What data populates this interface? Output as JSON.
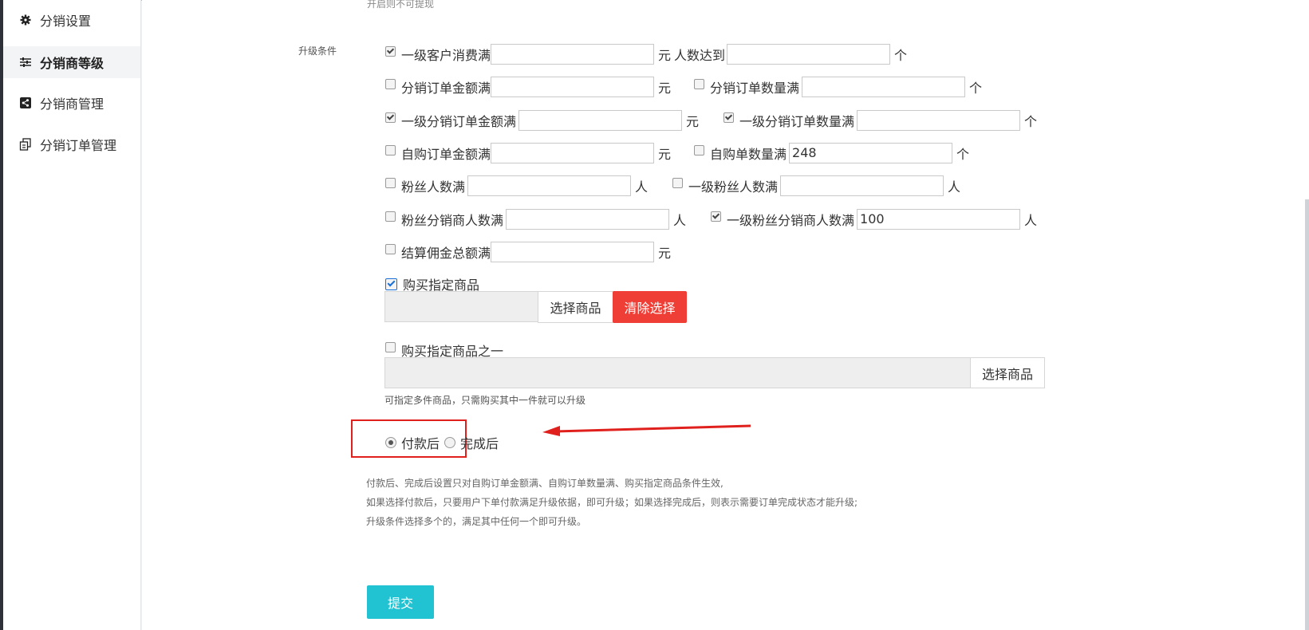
{
  "sidebar": {
    "items": [
      {
        "label": "分销设置",
        "icon": "gear-icon"
      },
      {
        "label": "分销商等级",
        "icon": "sliders-icon"
      },
      {
        "label": "分销商管理",
        "icon": "share-icon"
      },
      {
        "label": "分销订单管理",
        "icon": "copy-icon"
      }
    ]
  },
  "form": {
    "top_hint": "开启则不可提现",
    "upgrade_label": "升级条件",
    "row1": {
      "label1": "一级客户消费满",
      "value1": "",
      "unit1": "元",
      "label2": "人数达到",
      "value2": "",
      "unit2": "个"
    },
    "row2": {
      "label1": "分销订单金额满",
      "value1": "",
      "unit1": "元",
      "label2": "分销订单数量满",
      "value2": "",
      "unit2": "个"
    },
    "row3": {
      "label1": "一级分销订单金额满",
      "value1": "",
      "unit1": "元",
      "label2": "一级分销订单数量满",
      "value2": "",
      "unit2": "个"
    },
    "row4": {
      "label1": "自购订单金额满",
      "value1": "",
      "unit1": "元",
      "label2": "自购单数量满",
      "value2": "248",
      "unit2": "个"
    },
    "row5": {
      "label1": "粉丝人数满",
      "value1": "",
      "unit1": "人",
      "label2": "一级粉丝人数满",
      "value2": "",
      "unit2": "人"
    },
    "row6": {
      "label1": "粉丝分销商人数满",
      "value1": "",
      "unit1": "人",
      "label2": "一级粉丝分销商人数满",
      "value2": "100",
      "unit2": "人"
    },
    "row7": {
      "label1": "结算佣金总额满",
      "value1": "",
      "unit1": "元"
    },
    "buy_goods": {
      "label": "购买指定商品",
      "select_label": "选择商品",
      "clear_label": "清除选择"
    },
    "buy_one_of": {
      "label": "购买指定商品之一",
      "select_label": "选择商品",
      "hint": "可指定多件商品，只需购买其中一件就可以升级"
    },
    "timing": {
      "option1": "付款后",
      "option2": "完成后",
      "selected": "付款后"
    },
    "desc": [
      "付款后、完成后设置只对自购订单金额满、自购订单数量满、购买指定商品条件生效,",
      "如果选择付款后，只要用户下单付款满足升级依据，即可升级；如果选择完成后，则表示需要订单完成状态才能升级;",
      "升级条件选择多个的，满足其中任何一个即可升级。"
    ],
    "submit_label": "提交"
  },
  "colors": {
    "accent": "#21c2d2",
    "danger": "#ef3e36",
    "annotation": "#e0201d"
  }
}
